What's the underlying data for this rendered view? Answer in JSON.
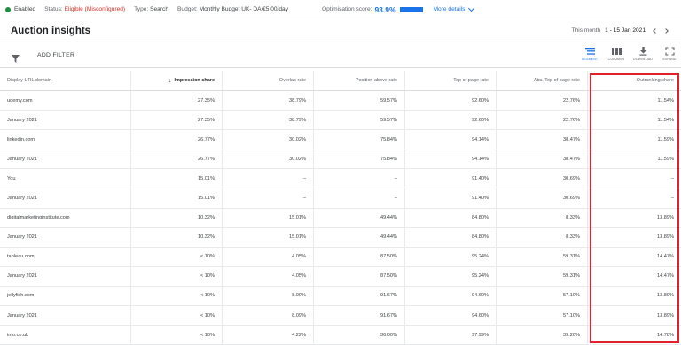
{
  "status": {
    "enabled_label": "Enabled",
    "status_key": "Status:",
    "status_value": "Eligible (Misconfigured)",
    "type_key": "Type:",
    "type_value": "Search",
    "budget_key": "Budget:",
    "budget_value": "Monthly Budget UK- DA €5.00/day",
    "opt_key": "Optimisation score:",
    "opt_value": "93.9%",
    "more_details": "More details",
    "colors": {
      "enabled_dot": "#1e8e3e",
      "warning": "#d93025",
      "accent": "#1a73e8"
    }
  },
  "header": {
    "title": "Auction insights",
    "date_prefix": "This month",
    "date_value": "1 - 15 Jan 2021"
  },
  "toolbar": {
    "add_filter": "ADD FILTER",
    "segment": "SEGMENT",
    "columns": "COLUMNS",
    "download": "DOWNLOAD",
    "expand": "EXPAND"
  },
  "table": {
    "sort_arrow": "↓",
    "columns": [
      "Display URL domain",
      "Impression share",
      "Overlap rate",
      "Position above rate",
      "Top of page rate",
      "Abs. Top of page rate",
      "Outranking share"
    ],
    "rows": [
      [
        "udemy.com",
        "27.35%",
        "38.79%",
        "59.57%",
        "92.60%",
        "22.76%",
        "11.54%"
      ],
      [
        "January 2021",
        "27.35%",
        "38.79%",
        "59.57%",
        "92.60%",
        "22.76%",
        "11.54%"
      ],
      [
        "linkedin.com",
        "26.77%",
        "30.02%",
        "75.84%",
        "94.14%",
        "38.47%",
        "11.59%"
      ],
      [
        "January 2021",
        "26.77%",
        "30.02%",
        "75.84%",
        "94.14%",
        "38.47%",
        "11.59%"
      ],
      [
        "You",
        "15.01%",
        "–",
        "–",
        "91.40%",
        "30.69%",
        "–"
      ],
      [
        "January 2021",
        "15.01%",
        "–",
        "–",
        "91.40%",
        "30.69%",
        "–"
      ],
      [
        "digitalmarketinginstitute.com",
        "10.32%",
        "15.01%",
        "49.44%",
        "84.80%",
        "8.33%",
        "13.89%"
      ],
      [
        "January 2021",
        "10.32%",
        "15.01%",
        "49.44%",
        "84.80%",
        "8.33%",
        "13.89%"
      ],
      [
        "tableau.com",
        "< 10%",
        "4.05%",
        "87.50%",
        "95.24%",
        "59.31%",
        "14.47%"
      ],
      [
        "January 2021",
        "< 10%",
        "4.05%",
        "87.50%",
        "95.24%",
        "59.31%",
        "14.47%"
      ],
      [
        "jellyfish.com",
        "< 10%",
        "8.09%",
        "91.67%",
        "94.60%",
        "57.10%",
        "13.89%"
      ],
      [
        "January 2021",
        "< 10%",
        "8.09%",
        "91.67%",
        "94.60%",
        "57.10%",
        "13.89%"
      ],
      [
        "info.co.uk",
        "< 10%",
        "4.22%",
        "36.00%",
        "97.99%",
        "39.20%",
        "14.78%"
      ]
    ]
  },
  "highlight_color": "#e0202a"
}
